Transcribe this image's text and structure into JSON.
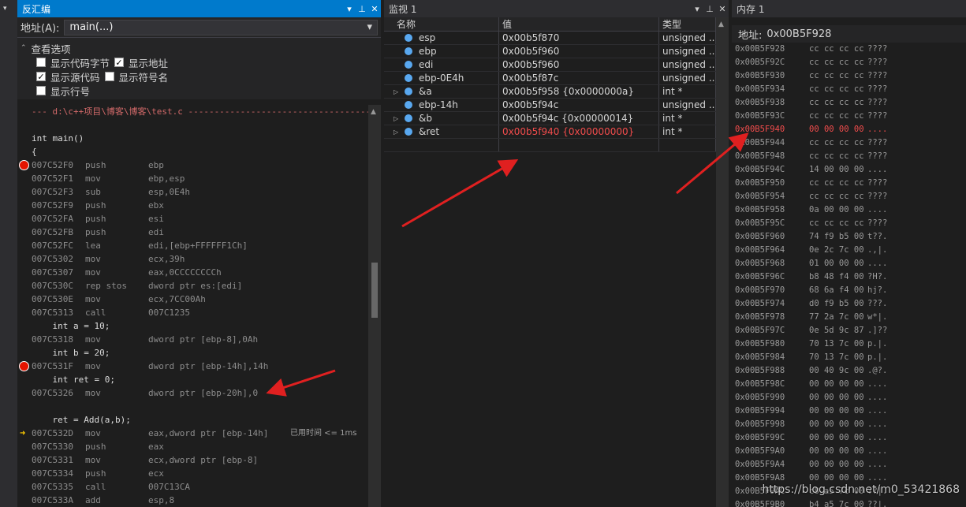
{
  "disasm": {
    "title": "反汇编",
    "address_label": "地址(A):",
    "address_value": "main(...)",
    "options_label": "查看选项",
    "opt_code_bytes": "显示代码字节",
    "opt_address": "显示地址",
    "opt_source": "显示源代码",
    "opt_symbols": "显示符号名",
    "opt_line_numbers": "显示行号",
    "lines": [
      {
        "kind": "file",
        "src": "--- d:\\c++项目\\博客\\博客\\test.c -----------------------------------"
      },
      {
        "kind": "blank"
      },
      {
        "kind": "src",
        "src": "int main()"
      },
      {
        "kind": "src",
        "src": "{"
      },
      {
        "kind": "asm",
        "addr": "007C52F0",
        "mn": "push",
        "op": "ebp",
        "bp": true
      },
      {
        "kind": "asm",
        "addr": "007C52F1",
        "mn": "mov",
        "op": "ebp,esp"
      },
      {
        "kind": "asm",
        "addr": "007C52F3",
        "mn": "sub",
        "op": "esp,0E4h"
      },
      {
        "kind": "asm",
        "addr": "007C52F9",
        "mn": "push",
        "op": "ebx"
      },
      {
        "kind": "asm",
        "addr": "007C52FA",
        "mn": "push",
        "op": "esi"
      },
      {
        "kind": "asm",
        "addr": "007C52FB",
        "mn": "push",
        "op": "edi"
      },
      {
        "kind": "asm",
        "addr": "007C52FC",
        "mn": "lea",
        "op": "edi,[ebp+FFFFFF1Ch]"
      },
      {
        "kind": "asm",
        "addr": "007C5302",
        "mn": "mov",
        "op": "ecx,39h"
      },
      {
        "kind": "asm",
        "addr": "007C5307",
        "mn": "mov",
        "op": "eax,0CCCCCCCCh"
      },
      {
        "kind": "asm",
        "addr": "007C530C",
        "mn": "rep stos",
        "op": "dword ptr es:[edi]"
      },
      {
        "kind": "asm",
        "addr": "007C530E",
        "mn": "mov",
        "op": "ecx,7CC00Ah"
      },
      {
        "kind": "asm",
        "addr": "007C5313",
        "mn": "call",
        "op": "007C1235"
      },
      {
        "kind": "src",
        "src": "    int a = 10;"
      },
      {
        "kind": "asm",
        "addr": "007C5318",
        "mn": "mov",
        "op": "dword ptr [ebp-8],0Ah"
      },
      {
        "kind": "src",
        "src": "    int b = 20;"
      },
      {
        "kind": "asm",
        "addr": "007C531F",
        "mn": "mov",
        "op": "dword ptr [ebp-14h],14h",
        "bp": true
      },
      {
        "kind": "src",
        "src": "    int ret = 0;"
      },
      {
        "kind": "asm",
        "addr": "007C5326",
        "mn": "mov",
        "op": "dword ptr [ebp-20h],0"
      },
      {
        "kind": "blank"
      },
      {
        "kind": "src",
        "src": "    ret = Add(a,b);"
      },
      {
        "kind": "asm",
        "addr": "007C532D",
        "mn": "mov",
        "op": "eax,dword ptr [ebp-14h]",
        "cur": true,
        "note": "已用时间 <= 1ms"
      },
      {
        "kind": "asm",
        "addr": "007C5330",
        "mn": "push",
        "op": "eax"
      },
      {
        "kind": "asm",
        "addr": "007C5331",
        "mn": "mov",
        "op": "ecx,dword ptr [ebp-8]"
      },
      {
        "kind": "asm",
        "addr": "007C5334",
        "mn": "push",
        "op": "ecx"
      },
      {
        "kind": "asm",
        "addr": "007C5335",
        "mn": "call",
        "op": "007C13CA"
      },
      {
        "kind": "asm",
        "addr": "007C533A",
        "mn": "add",
        "op": "esp,8"
      }
    ]
  },
  "watch": {
    "title": "监视 1",
    "col_name": "名称",
    "col_value": "值",
    "col_type": "类型",
    "rows": [
      {
        "name": "esp",
        "value": "0x00b5f870",
        "type": "unsigned ...",
        "expandable": false,
        "changed": false
      },
      {
        "name": "ebp",
        "value": "0x00b5f960",
        "type": "unsigned ...",
        "expandable": false,
        "changed": false
      },
      {
        "name": "edi",
        "value": "0x00b5f960",
        "type": "unsigned ...",
        "expandable": false,
        "changed": false
      },
      {
        "name": "ebp-0E4h",
        "value": "0x00b5f87c",
        "type": "unsigned ...",
        "expandable": false,
        "changed": false
      },
      {
        "name": "&a",
        "value": "0x00b5f958 {0x0000000a}",
        "type": "int *",
        "expandable": true,
        "changed": false
      },
      {
        "name": "ebp-14h",
        "value": "0x00b5f94c",
        "type": "unsigned ...",
        "expandable": false,
        "changed": false
      },
      {
        "name": "&b",
        "value": "0x00b5f94c {0x00000014}",
        "type": "int *",
        "expandable": true,
        "changed": false
      },
      {
        "name": "&ret",
        "value": "0x00b5f940 {0x00000000}",
        "type": "int *",
        "expandable": true,
        "changed": true
      }
    ]
  },
  "memory": {
    "title": "内存 1",
    "address_label": "地址:",
    "address_value": "0x00B5F928",
    "rows": [
      {
        "addr": "0x00B5F928",
        "bytes": "cc cc cc cc",
        "chars": "????",
        "changed": false
      },
      {
        "addr": "0x00B5F92C",
        "bytes": "cc cc cc cc",
        "chars": "????",
        "changed": false
      },
      {
        "addr": "0x00B5F930",
        "bytes": "cc cc cc cc",
        "chars": "????",
        "changed": false
      },
      {
        "addr": "0x00B5F934",
        "bytes": "cc cc cc cc",
        "chars": "????",
        "changed": false
      },
      {
        "addr": "0x00B5F938",
        "bytes": "cc cc cc cc",
        "chars": "????",
        "changed": false
      },
      {
        "addr": "0x00B5F93C",
        "bytes": "cc cc cc cc",
        "chars": "????",
        "changed": false
      },
      {
        "addr": "0x00B5F940",
        "bytes": "00 00 00 00",
        "chars": "....",
        "changed": true
      },
      {
        "addr": "0x00B5F944",
        "bytes": "cc cc cc cc",
        "chars": "????",
        "changed": false
      },
      {
        "addr": "0x00B5F948",
        "bytes": "cc cc cc cc",
        "chars": "????",
        "changed": false
      },
      {
        "addr": "0x00B5F94C",
        "bytes": "14 00 00 00",
        "chars": "....",
        "changed": false
      },
      {
        "addr": "0x00B5F950",
        "bytes": "cc cc cc cc",
        "chars": "????",
        "changed": false
      },
      {
        "addr": "0x00B5F954",
        "bytes": "cc cc cc cc",
        "chars": "????",
        "changed": false
      },
      {
        "addr": "0x00B5F958",
        "bytes": "0a 00 00 00",
        "chars": "....",
        "changed": false
      },
      {
        "addr": "0x00B5F95C",
        "bytes": "cc cc cc cc",
        "chars": "????",
        "changed": false
      },
      {
        "addr": "0x00B5F960",
        "bytes": "74 f9 b5 00",
        "chars": "t??.",
        "changed": false
      },
      {
        "addr": "0x00B5F964",
        "bytes": "0e 2c 7c 00",
        "chars": ".,|.",
        "changed": false
      },
      {
        "addr": "0x00B5F968",
        "bytes": "01 00 00 00",
        "chars": "....",
        "changed": false
      },
      {
        "addr": "0x00B5F96C",
        "bytes": "b8 48 f4 00",
        "chars": "?H?.",
        "changed": false
      },
      {
        "addr": "0x00B5F970",
        "bytes": "68 6a f4 00",
        "chars": "hj?.",
        "changed": false
      },
      {
        "addr": "0x00B5F974",
        "bytes": "d0 f9 b5 00",
        "chars": "???.",
        "changed": false
      },
      {
        "addr": "0x00B5F978",
        "bytes": "77 2a 7c 00",
        "chars": "w*|.",
        "changed": false
      },
      {
        "addr": "0x00B5F97C",
        "bytes": "0e 5d 9c 87",
        "chars": ".]??",
        "changed": false
      },
      {
        "addr": "0x00B5F980",
        "bytes": "70 13 7c 00",
        "chars": "p.|.",
        "changed": false
      },
      {
        "addr": "0x00B5F984",
        "bytes": "70 13 7c 00",
        "chars": "p.|.",
        "changed": false
      },
      {
        "addr": "0x00B5F988",
        "bytes": "00 40 9c 00",
        "chars": ".@?.",
        "changed": false
      },
      {
        "addr": "0x00B5F98C",
        "bytes": "00 00 00 00",
        "chars": "....",
        "changed": false
      },
      {
        "addr": "0x00B5F990",
        "bytes": "00 00 00 00",
        "chars": "....",
        "changed": false
      },
      {
        "addr": "0x00B5F994",
        "bytes": "00 00 00 00",
        "chars": "....",
        "changed": false
      },
      {
        "addr": "0x00B5F998",
        "bytes": "00 00 00 00",
        "chars": "....",
        "changed": false
      },
      {
        "addr": "0x00B5F99C",
        "bytes": "00 00 00 00",
        "chars": "....",
        "changed": false
      },
      {
        "addr": "0x00B5F9A0",
        "bytes": "00 00 00 00",
        "chars": "....",
        "changed": false
      },
      {
        "addr": "0x00B5F9A4",
        "bytes": "00 00 00 00",
        "chars": "....",
        "changed": false
      },
      {
        "addr": "0x00B5F9A8",
        "bytes": "00 00 00 00",
        "chars": "....",
        "changed": false
      },
      {
        "addr": "0x00B5F9AC",
        "bytes": "c8 a5 7c 00",
        "chars": "??|.",
        "changed": false
      },
      {
        "addr": "0x00B5F9B0",
        "bytes": "b4 a5 7c 00",
        "chars": "??|.",
        "changed": false
      }
    ]
  },
  "watermark": "https://blog.csdn.net/m0_53421868",
  "colors": {
    "accent": "#007acc",
    "changed": "#f14c4c",
    "breakpoint": "#e51400",
    "annotation_arrow": "#e02020"
  }
}
